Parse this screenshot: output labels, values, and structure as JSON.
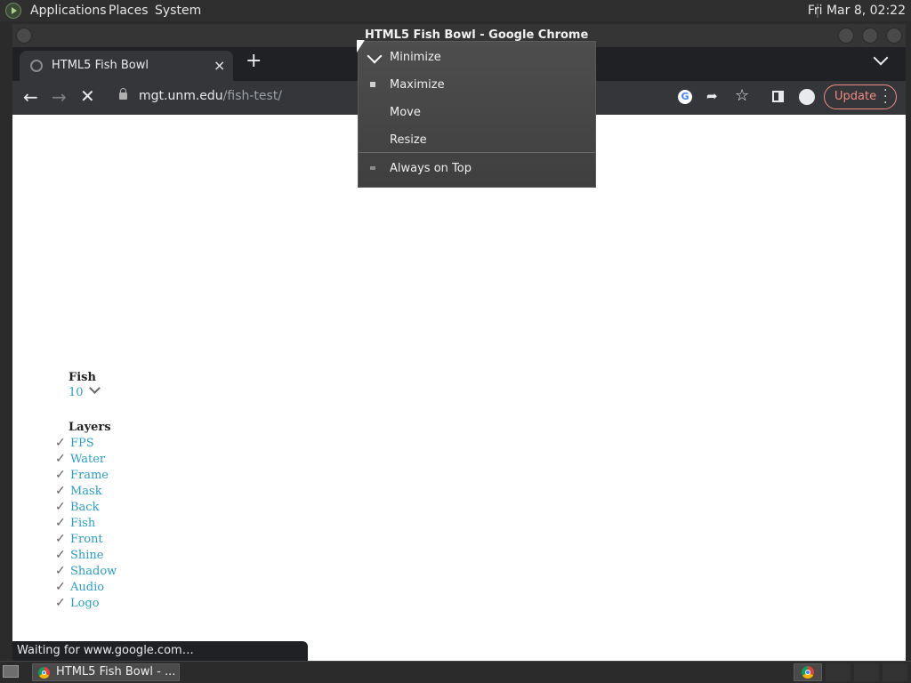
{
  "top_panel": {
    "menus": [
      "Applications",
      "Places",
      "System"
    ],
    "clock": "Fri Mar  8, 02:22"
  },
  "window": {
    "title": "HTML5 Fish Bowl - Google Chrome"
  },
  "browser": {
    "tab_title": "HTML5 Fish Bowl",
    "tab_close": "×",
    "new_tab": "+",
    "url_host": "mgt.unm.edu",
    "url_path": "/fish-test/",
    "update_label": "Update",
    "status_text": "Waiting for www.google.com…"
  },
  "page": {
    "fish_label": "Fish",
    "fish_value": "10",
    "layers_label": "Layers",
    "layers": [
      "FPS",
      "Water",
      "Frame",
      "Mask",
      "Back",
      "Fish",
      "Front",
      "Shine",
      "Shadow",
      "Audio",
      "Logo"
    ]
  },
  "context_menu": {
    "items": [
      "Minimize",
      "Maximize",
      "Move",
      "Resize",
      "Always on Top"
    ]
  },
  "taskbar": {
    "task_label": "HTML5 Fish Bowl - ..."
  },
  "colors": {
    "link": "#2a9fc9",
    "update_accent": "#f28b82"
  }
}
